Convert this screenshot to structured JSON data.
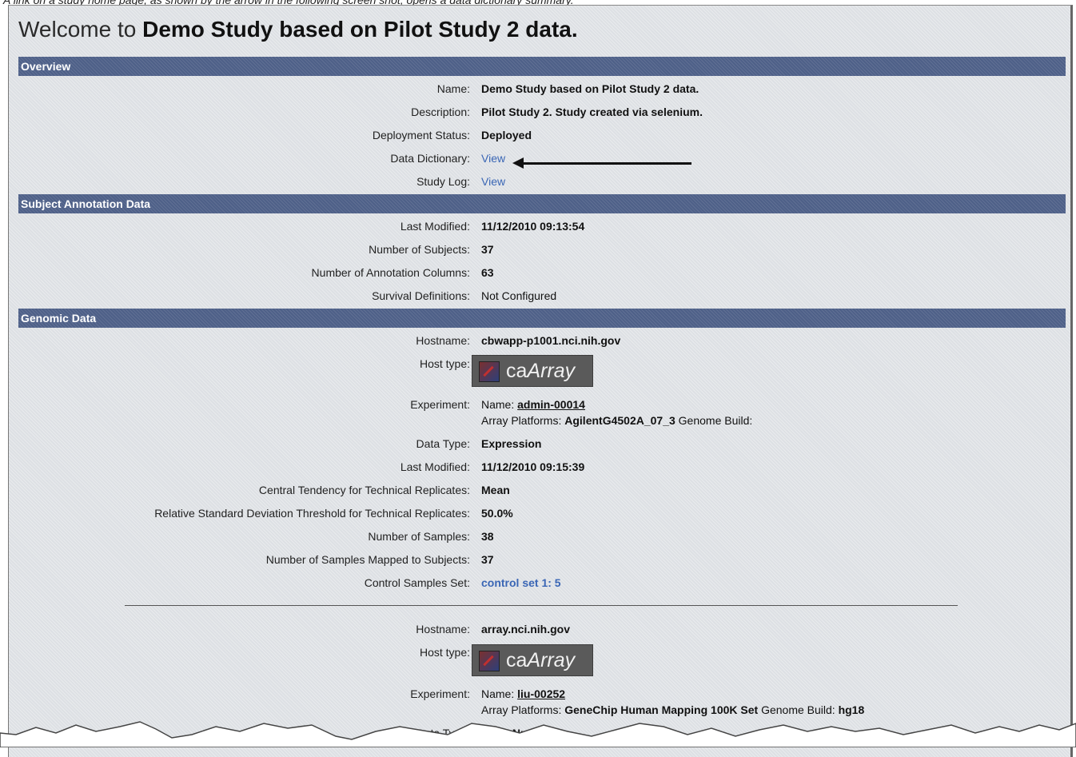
{
  "caption": "A link on a study home page, as shown by the arrow in the following screen shot, opens a data dictionary summary.",
  "welcome": {
    "prefix": "Welcome to ",
    "study": "Demo Study based on Pilot Study 2 data."
  },
  "overview": {
    "header": "Overview",
    "rows": [
      {
        "label": "Name:",
        "value": "Demo Study based on Pilot Study 2 data."
      },
      {
        "label": "Description:",
        "value": "Pilot Study 2. Study created via selenium."
      },
      {
        "label": "Deployment Status:",
        "value": "Deployed"
      },
      {
        "label": "Data Dictionary:",
        "value": "View"
      },
      {
        "label": "Study Log:",
        "value": "View"
      }
    ]
  },
  "subject": {
    "header": "Subject Annotation Data",
    "rows": [
      {
        "label": "Last Modified:",
        "value": "11/12/2010 09:13:54"
      },
      {
        "label": "Number of Subjects:",
        "value": "37"
      },
      {
        "label": "Number of Annotation Columns:",
        "value": "63"
      },
      {
        "label": "Survival Definitions:",
        "value": "Not Configured"
      }
    ]
  },
  "genomic": {
    "header": "Genomic Data",
    "block1": {
      "hostname_label": "Hostname:",
      "hostname": "cbwapp-p1001.nci.nih.gov",
      "hosttype_label": "Host type:",
      "logo_prefix": "ca",
      "logo_suffix": "Array",
      "experiment_label": "Experiment:",
      "exp_name_label": "Name:",
      "exp_name": "admin-00014",
      "platforms_label": "Array Platforms:",
      "platforms": "AgilentG4502A_07_3",
      "build_label": "Genome Build:",
      "build": "",
      "rows": [
        {
          "label": "Data Type:",
          "value": "Expression"
        },
        {
          "label": "Last Modified:",
          "value": "11/12/2010 09:15:39"
        },
        {
          "label": "Central Tendency for Technical Replicates:",
          "value": "Mean"
        },
        {
          "label": "Relative Standard Deviation Threshold for Technical Replicates:",
          "value": "50.0%"
        },
        {
          "label": "Number of Samples:",
          "value": "38"
        },
        {
          "label": "Number of Samples Mapped to Subjects:",
          "value": "37"
        },
        {
          "label": "Control Samples Set:",
          "value": "control set 1: 5"
        }
      ]
    },
    "block2": {
      "hostname_label": "Hostname:",
      "hostname": "array.nci.nih.gov",
      "hosttype_label": "Host type:",
      "logo_prefix": "ca",
      "logo_suffix": "Array",
      "experiment_label": "Experiment:",
      "exp_name_label": "Name:",
      "exp_name": "liu-00252",
      "platforms_label": "Array Platforms:",
      "platforms": "GeneChip Human Mapping 100K Set",
      "build_label": "Genome Build:",
      "build": "hg18",
      "rows": [
        {
          "label": "Data Type:",
          "value": "Copy Number"
        }
      ]
    }
  }
}
